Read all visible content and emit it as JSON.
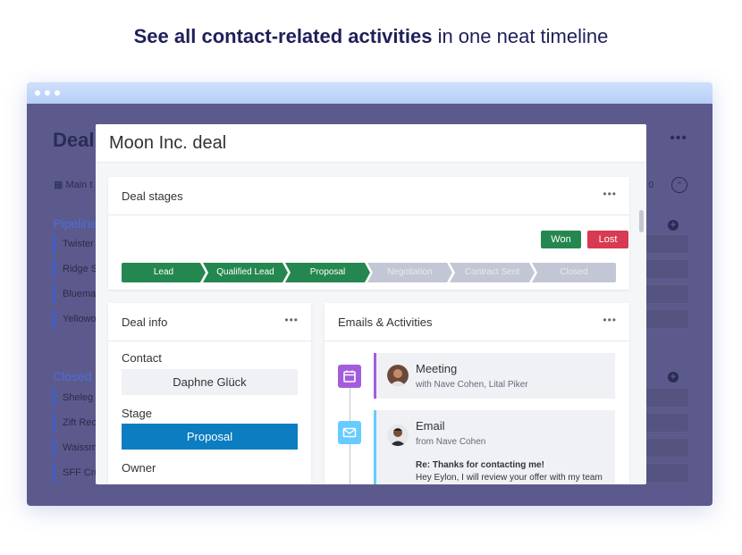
{
  "headline": {
    "bold": "See all contact-related activities",
    "rest": " in one neat timeline"
  },
  "background": {
    "title": "Deal",
    "main_tab": "Main t",
    "count": "0",
    "groups": [
      {
        "name": "Pipeline",
        "rows": [
          "Twister",
          "Ridge S",
          "Bluema",
          "Yellowo"
        ]
      },
      {
        "name": "Closed",
        "rows": [
          "Sheleg",
          "Zift Rec",
          "Waissm",
          "SFF Cru"
        ]
      }
    ]
  },
  "modal": {
    "title": "Moon Inc. deal",
    "deal_stages": {
      "title": "Deal stages",
      "won_label": "Won",
      "lost_label": "Lost",
      "stages": [
        {
          "label": "Lead",
          "state": "done"
        },
        {
          "label": "Qualified Lead",
          "state": "done"
        },
        {
          "label": "Proposal",
          "state": "done"
        },
        {
          "label": "Negotiation",
          "state": "todo"
        },
        {
          "label": "Contract Sent",
          "state": "todo"
        },
        {
          "label": "Closed",
          "state": "todo"
        }
      ]
    },
    "deal_info": {
      "title": "Deal info",
      "contact_label": "Contact",
      "contact_value": "Daphne Glück",
      "stage_label": "Stage",
      "stage_value": "Proposal",
      "owner_label": "Owner"
    },
    "activities": {
      "title": "Emails & Activities",
      "items": [
        {
          "type": "Meeting",
          "sub": "with Nave Cohen, Lital Piker"
        },
        {
          "type": "Email",
          "sub": "from Nave Cohen",
          "subject": "Re: Thanks for contacting me!",
          "body": "Hey Eylon, I will review your offer with my team"
        }
      ]
    }
  },
  "colors": {
    "won": "#258750",
    "lost": "#d83a52",
    "stage_blue": "#0b7dc0",
    "meeting": "#a25ddc",
    "email": "#66ccff"
  }
}
